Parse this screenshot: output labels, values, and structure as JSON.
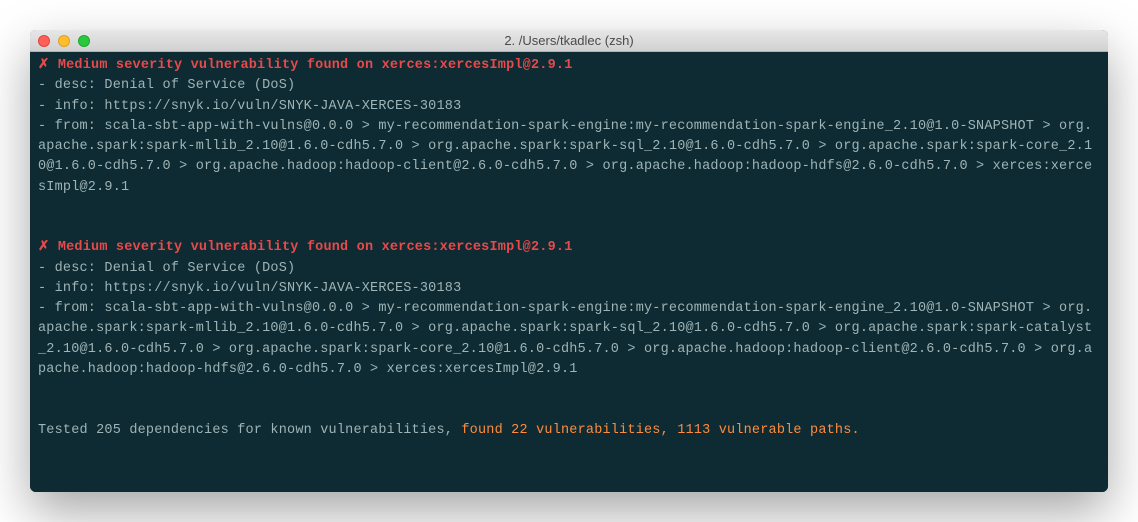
{
  "window": {
    "title": "2. /Users/tkadlec (zsh)"
  },
  "vuln1": {
    "header": "✗ Medium severity vulnerability found on xerces:xercesImpl@2.9.1",
    "desc": "- desc: Denial of Service (DoS)",
    "info": "- info: https://snyk.io/vuln/SNYK-JAVA-XERCES-30183",
    "from": "- from: scala-sbt-app-with-vulns@0.0.0 > my-recommendation-spark-engine:my-recommendation-spark-engine_2.10@1.0-SNAPSHOT > org.apache.spark:spark-mllib_2.10@1.6.0-cdh5.7.0 > org.apache.spark:spark-sql_2.10@1.6.0-cdh5.7.0 > org.apache.spark:spark-core_2.10@1.6.0-cdh5.7.0 > org.apache.hadoop:hadoop-client@2.6.0-cdh5.7.0 > org.apache.hadoop:hadoop-hdfs@2.6.0-cdh5.7.0 > xerces:xercesImpl@2.9.1"
  },
  "vuln2": {
    "header": "✗ Medium severity vulnerability found on xerces:xercesImpl@2.9.1",
    "desc": "- desc: Denial of Service (DoS)",
    "info": "- info: https://snyk.io/vuln/SNYK-JAVA-XERCES-30183",
    "from": "- from: scala-sbt-app-with-vulns@0.0.0 > my-recommendation-spark-engine:my-recommendation-spark-engine_2.10@1.0-SNAPSHOT > org.apache.spark:spark-mllib_2.10@1.6.0-cdh5.7.0 > org.apache.spark:spark-sql_2.10@1.6.0-cdh5.7.0 > org.apache.spark:spark-catalyst_2.10@1.6.0-cdh5.7.0 > org.apache.spark:spark-core_2.10@1.6.0-cdh5.7.0 > org.apache.hadoop:hadoop-client@2.6.0-cdh5.7.0 > org.apache.hadoop:hadoop-hdfs@2.6.0-cdh5.7.0 > xerces:xercesImpl@2.9.1"
  },
  "summary": {
    "prefix": "Tested 205 dependencies for known vulnerabilities, ",
    "highlight": "found 22 vulnerabilities, 1113 vulnerable paths."
  }
}
